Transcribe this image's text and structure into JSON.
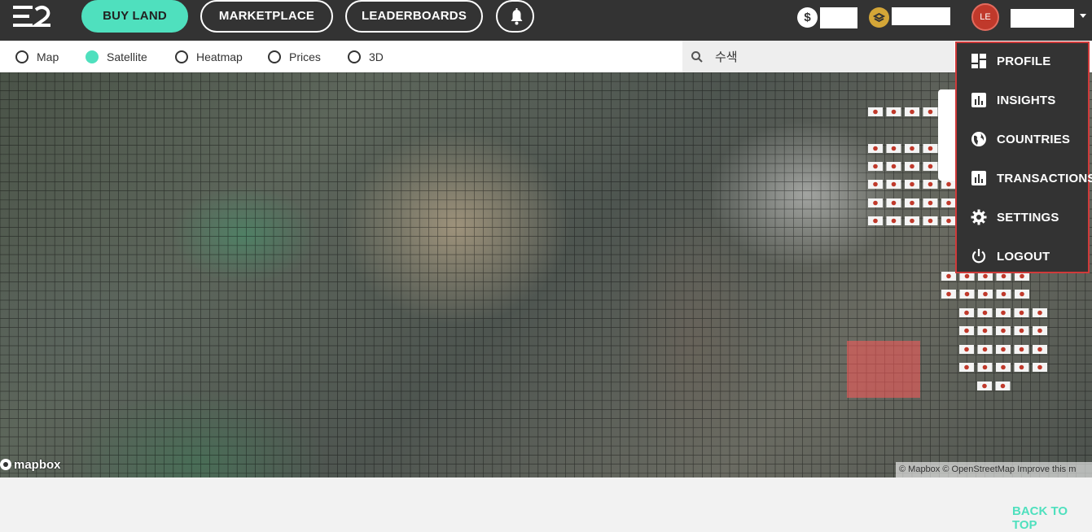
{
  "header": {
    "nav": {
      "buy_land": "BUY LAND",
      "marketplace": "MARKETPLACE",
      "leaderboards": "LEADERBOARDS"
    },
    "currency_symbol": "$",
    "accent_color": "#4fe0be",
    "avatar_initials": "LE"
  },
  "view_options": {
    "map": "Map",
    "satellite": "Satellite",
    "heatmap": "Heatmap",
    "prices": "Prices",
    "three_d": "3D",
    "selected": "Satellite"
  },
  "search": {
    "value": "수색"
  },
  "map": {
    "logo_text": "mapbox",
    "attribution": "© Mapbox © OpenStreetMap Improve this m"
  },
  "user_menu": {
    "items": [
      {
        "label": "PROFILE",
        "icon": "dashboard-icon"
      },
      {
        "label": "INSIGHTS",
        "icon": "bar-chart-icon"
      },
      {
        "label": "COUNTRIES",
        "icon": "globe-icon"
      },
      {
        "label": "TRANSACTIONS",
        "icon": "bar-chart-icon"
      },
      {
        "label": "SETTINGS",
        "icon": "gear-icon"
      },
      {
        "label": "LOGOUT",
        "icon": "power-icon"
      }
    ]
  },
  "footer": {
    "back_to_top": "BACK TO TOP"
  }
}
